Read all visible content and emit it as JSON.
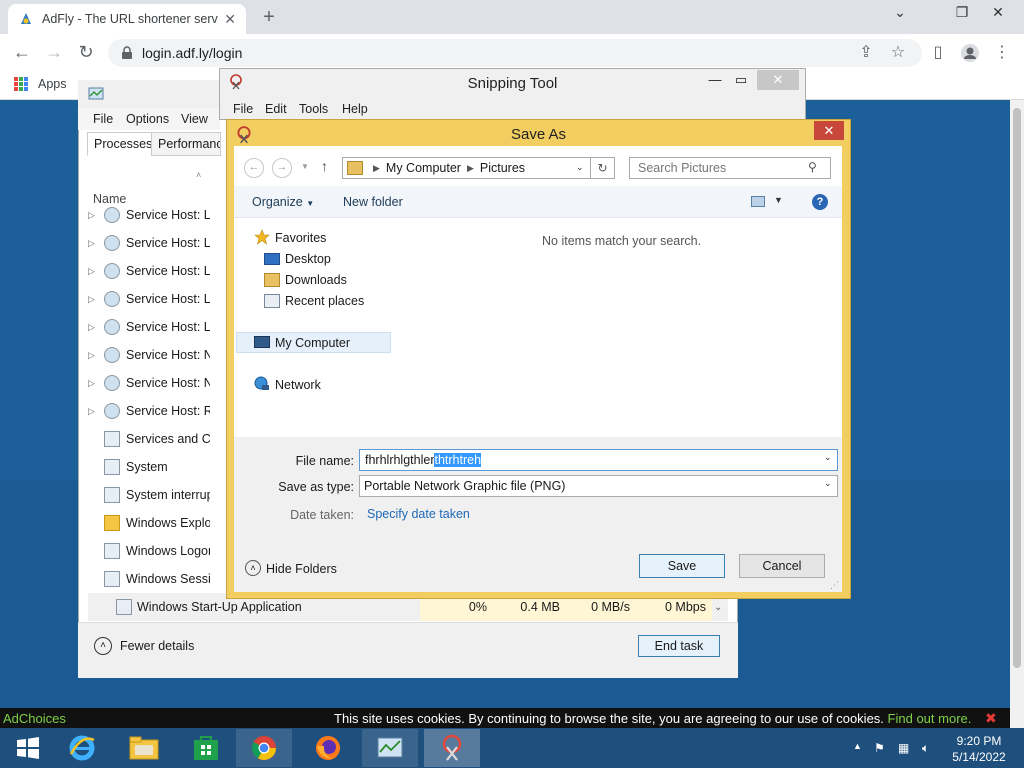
{
  "browser": {
    "tab_title": "AdFly - The URL shortener servic",
    "url": "login.adf.ly/login",
    "bookmarks_apps": "Apps"
  },
  "page": {
    "adchoices": "AdChoices",
    "cookie_text": "This site uses cookies. By continuing to browse the site, you are agreeing to our use of cookies.",
    "cookie_link": "Find out more."
  },
  "taskmgr": {
    "menu": [
      "File",
      "Options",
      "View"
    ],
    "tabs": [
      "Processes",
      "Performanc"
    ],
    "name_header": "Name",
    "processes": [
      {
        "name": "Service Host: Lo",
        "icon": "gear"
      },
      {
        "name": "Service Host: Lo",
        "icon": "gear"
      },
      {
        "name": "Service Host: Lo",
        "icon": "gear"
      },
      {
        "name": "Service Host: Lo",
        "icon": "gear"
      },
      {
        "name": "Service Host: Lo",
        "icon": "gear"
      },
      {
        "name": "Service Host: N",
        "icon": "gear"
      },
      {
        "name": "Service Host: N",
        "icon": "gear"
      },
      {
        "name": "Service Host: Re",
        "icon": "gear"
      },
      {
        "name": "Services and Co",
        "icon": "window"
      },
      {
        "name": "System",
        "icon": "window"
      },
      {
        "name": "System interrup",
        "icon": "window"
      },
      {
        "name": "Windows Explo",
        "icon": "folder"
      },
      {
        "name": "Windows Logon",
        "icon": "window"
      },
      {
        "name": "Windows Session",
        "icon": "window"
      }
    ],
    "last_process": {
      "name": "Windows Start-Up Application",
      "cpu": "0%",
      "memory": "0.4 MB",
      "disk": "0 MB/s",
      "network": "0 Mbps"
    },
    "fewer_details": "Fewer details",
    "end_task": "End task"
  },
  "snipping": {
    "title": "Snipping Tool",
    "menu": [
      "File",
      "Edit",
      "Tools",
      "Help"
    ]
  },
  "saveas": {
    "title": "Save As",
    "path": [
      "My Computer",
      "Pictures"
    ],
    "search_placeholder": "Search Pictures",
    "organize": "Organize",
    "new_folder": "New folder",
    "empty_message": "No items match your search.",
    "tree": {
      "favorites": "Favorites",
      "desktop": "Desktop",
      "downloads": "Downloads",
      "recent": "Recent places",
      "my_computer": "My Computer",
      "network": "Network"
    },
    "file_name_label": "File name:",
    "file_name_plain": "fhrhlrhlgthler",
    "file_name_selected": "thtrhtreh",
    "save_type_label": "Save as type:",
    "save_type_value": "Portable Network Graphic file (PNG)",
    "date_taken_label": "Date taken:",
    "date_taken_link": "Specify date taken",
    "hide_folders": "Hide Folders",
    "save": "Save",
    "cancel": "Cancel"
  },
  "taskbar": {
    "time": "9:20 PM",
    "date": "5/14/2022"
  }
}
